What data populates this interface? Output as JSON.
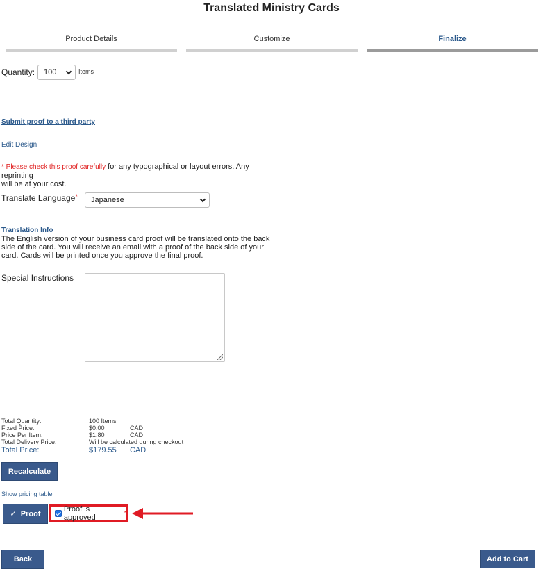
{
  "page": {
    "title": "Translated Ministry Cards"
  },
  "steps": [
    {
      "label": "Product Details",
      "active": false
    },
    {
      "label": "Customize",
      "active": false
    },
    {
      "label": "Finalize",
      "active": true
    }
  ],
  "quantity": {
    "label": "Quantity:",
    "value": "100",
    "unit": "Items"
  },
  "links": {
    "submit_proof": "Submit proof to a third party",
    "edit_design": "Edit Design",
    "translation_info": "Translation Info",
    "show_pricing": "Show pricing table"
  },
  "warning": {
    "red_text": "* Please check this proof carefully",
    "rest_line1": " for any typographical or layout errors. Any reprinting",
    "rest_line2": "will be at your cost."
  },
  "translate": {
    "label": "Translate Language",
    "required_mark": "*",
    "value": "Japanese"
  },
  "translation_text": {
    "line1": "The English version of your business card proof will be translated onto the back",
    "line2": "side of the card. You will receive an email with a proof of the back side of your",
    "line3": "card. Cards will be printed once you approve the final proof."
  },
  "special_instructions": {
    "label": "Special Instructions",
    "value": ""
  },
  "summary": {
    "total_quantity": {
      "label": "Total Quantity:",
      "value": "100 Items",
      "currency": ""
    },
    "fixed_price": {
      "label": "Fixed Price:",
      "value": "$0.00",
      "currency": "CAD"
    },
    "price_per_item": {
      "label": "Price Per Item:",
      "value": "$1.80",
      "currency": "CAD"
    },
    "total_delivery": {
      "label": "Total Delivery Price:",
      "value": "Will be calculated during checkout",
      "currency": ""
    },
    "total_price": {
      "label": "Total Price:",
      "value": "$179.55",
      "currency": "CAD"
    }
  },
  "buttons": {
    "recalculate": "Recalculate",
    "proof": "Proof",
    "proof_check": "✓",
    "back": "Back",
    "add_to_cart": "Add to Cart"
  },
  "approval": {
    "label": "Proof is approved",
    "required_mark": "*",
    "checked": true
  },
  "colors": {
    "accent": "#2c5a8c",
    "button": "#3a5a8c",
    "highlight": "#e01b24",
    "required": "#e02020"
  }
}
